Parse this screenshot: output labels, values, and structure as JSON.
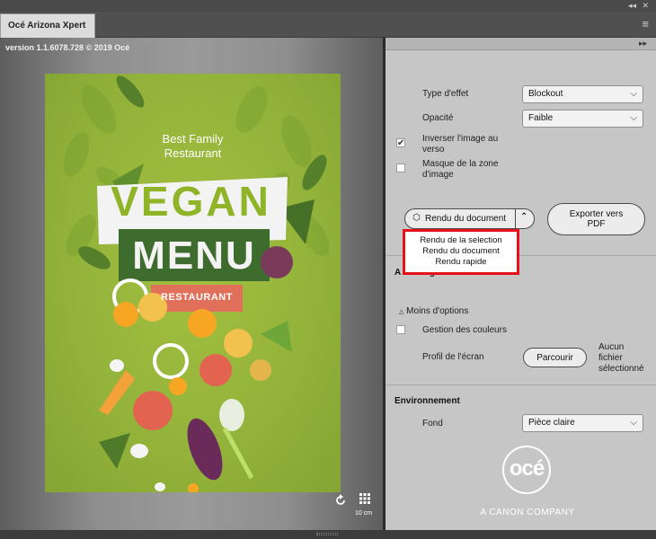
{
  "app": {
    "tab_title": "Océ Arizona Xpert",
    "version": "version 1.1.6078.728 © 2019 Océ"
  },
  "poster": {
    "line1": "Best Family",
    "line2": "Restaurant",
    "vegan": "VEGAN",
    "menu": "MENU",
    "restaurant": "RESTAURANT"
  },
  "preview": {
    "scale_label": "10 cm"
  },
  "settings": {
    "effect_label": "Type d'effet",
    "effect_value": "Blockout",
    "opacity_label": "Opacité",
    "opacity_value": "Faible",
    "invert_label_1": "Inverser l'image au",
    "invert_label_2": "verso",
    "invert_checked": true,
    "mask_label_1": "Masque de la zone",
    "mask_label_2": "d'image",
    "mask_checked": false,
    "render_button": "Rendu du document",
    "export_line1": "Exporter vers",
    "export_line2": "PDF"
  },
  "render_menu": {
    "options": [
      "Rendu de la selection",
      "Rendu du document",
      "Rendu rapide"
    ]
  },
  "display": {
    "section_title_partial": "A",
    "section_title_suffix": "age",
    "less_options": "Moins d'options",
    "color_mgmt": "Gestion des couleurs",
    "profile_label": "Profil de l'écran",
    "browse_button": "Parcourir",
    "no_file_1": "Aucun",
    "no_file_2": "fichier",
    "no_file_3": "sélectionné"
  },
  "environment": {
    "title": "Environnement",
    "background_label": "Fond",
    "background_value": "Pièce claire"
  },
  "brand": {
    "logo": "océ",
    "tagline": "A CANON COMPANY"
  },
  "colors": {
    "poster_green": "#92b23a",
    "vegan_green": "#8fb428",
    "menu_band": "#3e6b2e",
    "restaurant_band": "#e0705a",
    "highlight_red": "#e8101a"
  }
}
